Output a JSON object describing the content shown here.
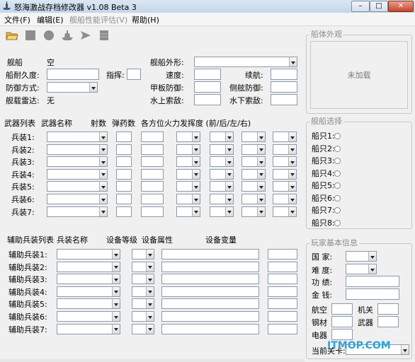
{
  "window": {
    "title": "怒海激战存档修改器 v1.08 Beta 3",
    "minimize": "–",
    "maximize": "□",
    "close": "✕"
  },
  "menu": [
    "文件(F)",
    "编辑(E)",
    "舰船性能评估(V)",
    "帮助(H)"
  ],
  "toolbar": [
    "open-icon",
    "save-icon",
    "circle-icon",
    "ship-icon",
    "plane-icon",
    "grid-icon"
  ],
  "ship": {
    "name_label": "舰船",
    "name_value": "空",
    "durability_label": "船耐久度:",
    "command_label": "指挥:",
    "defense_label": "防御方式:",
    "radar_label": "舰载雷达:",
    "radar_value": "无",
    "shape_label": "舰船外形:",
    "speed_label": "速度:",
    "range_label": "续航:",
    "deck_label": "甲板防御:",
    "side_label": "侧舷防御:",
    "surface_label": "水上索敌:",
    "underwater_label": "水下索敌:"
  },
  "weapons": {
    "headers": {
      "list": "武器列表",
      "name": "武器名称",
      "count": "射数",
      "ammo": "弹药数",
      "fire": "各方位火力发挥度 (前/后/左/右)"
    },
    "rows": [
      "兵装1:",
      "兵装2:",
      "兵装3:",
      "兵装4:",
      "兵装5:",
      "兵装6:",
      "兵装7:"
    ]
  },
  "aux": {
    "headers": {
      "list": "辅助兵装列表",
      "name": "兵装名称",
      "level": "设备等级",
      "attr": "设备属性",
      "var": "设备变量"
    },
    "rows": [
      "辅助兵装1:",
      "辅助兵装2:",
      "辅助兵装3:",
      "辅助兵装4:",
      "辅助兵装5:",
      "辅助兵装6:",
      "辅助兵装7:"
    ]
  },
  "appearance": {
    "title": "船体外观",
    "placeholder": "未加载"
  },
  "selection": {
    "title": "舰船选择",
    "items": [
      "船只1:",
      "船只2:",
      "船只3:",
      "船只4:",
      "船只5:",
      "船只6:",
      "船只7:",
      "船只8:"
    ]
  },
  "player": {
    "title": "玩家基本信息",
    "country": "国  家:",
    "difficulty": "难  度:",
    "merit": "功  绩:",
    "money": "金  钱:",
    "aviation": "航空",
    "machinery": "机关",
    "steel": "钢材",
    "weapon": "武器",
    "electric": "电器",
    "level": "当前关卡:"
  },
  "watermark": "ITMOP.COM"
}
